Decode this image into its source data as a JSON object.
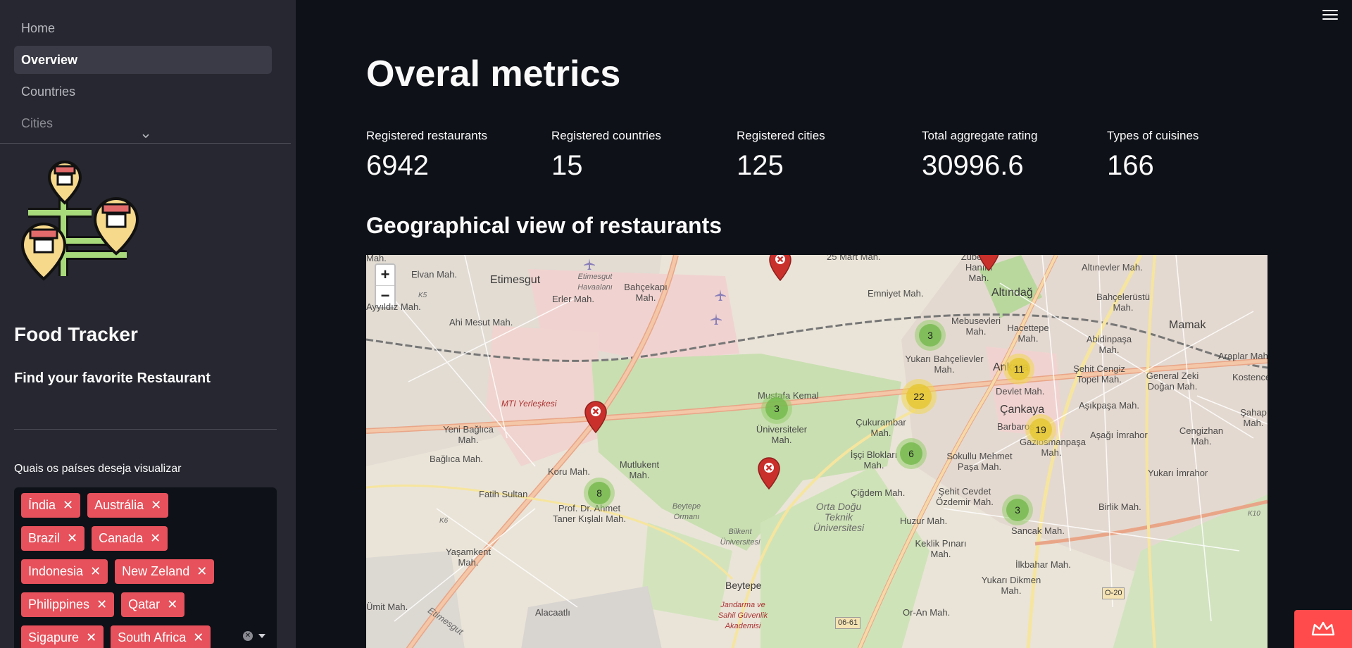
{
  "sidebar": {
    "nav": [
      {
        "label": "Home",
        "active": false
      },
      {
        "label": "Overview",
        "active": true
      },
      {
        "label": "Countries",
        "active": false
      },
      {
        "label": "Cities",
        "active": false
      }
    ],
    "brand": "Food Tracker",
    "subtitle": "Find your favorite Restaurant",
    "filter": {
      "label": "Quais os países deseja visualizar",
      "tags": [
        "Índia",
        "Austrália",
        "Brazil",
        "Canada",
        "Indonesia",
        "New Zeland",
        "Philippines",
        "Qatar",
        "Sigapure",
        "South Africa"
      ]
    }
  },
  "main": {
    "title": "Overal metrics",
    "metrics": [
      {
        "label": "Registered restaurants",
        "value": "6942"
      },
      {
        "label": "Registered countries",
        "value": "15"
      },
      {
        "label": "Registered cities",
        "value": "125"
      },
      {
        "label": "Total aggregate rating",
        "value": "30996.6"
      },
      {
        "label": "Types of cuisines",
        "value": "166"
      }
    ],
    "map_title": "Geographical view of restaurants"
  },
  "map": {
    "zoom_in": "+",
    "zoom_out": "−",
    "labels": {
      "l1": "Elvan Mah.",
      "l2": "Etimesgut",
      "l3": "Etimesgut Havaalanı",
      "l4": "Bahçekapı Mah.",
      "l5": "25 Mart Mah.",
      "l6": "Zübeyde Hanım Mah.",
      "l7": "Altınevler Mah.",
      "l8": "Erler Mah.",
      "l9": "Ahi Mesut Mah.",
      "l10": "Emniyet Mah.",
      "l11": "Altındağ",
      "l12": "Bahçelerüstü Mah.",
      "l13": "Mamak",
      "l14": "Mebusevleri Mah.",
      "l15": "Hacettepe Mah.",
      "l16": "Abidinpaşa Mah.",
      "l17": "Yukarı Bahçelievler Mah.",
      "l18": "Ankara",
      "l19": "Şehit Cengiz Topel Mah.",
      "l20": "General Zeki Doğan Mah.",
      "l21": "Araplar Mah.",
      "l22": "Kostence",
      "l23": "Devlet Mah.",
      "l24": "MTI Yerleşkesi",
      "l25": "Mustafa Kemal",
      "l26": "Çankaya",
      "l27": "Aşıkpaşa Mah.",
      "l28": "Yeni Bağlıca Mah.",
      "l29": "Üniversiteler Mah.",
      "l30": "Çukurambar Mah.",
      "l31": "Barbaros",
      "l32": "Gaziosmanpaşa Mah.",
      "l33": "Aşağı İmrahor",
      "l34": "Cengizhan Mah.",
      "l35": "Şahap Mah.",
      "l36": "Bağlıca Mah.",
      "l37": "Mutlukent Mah.",
      "l38": "İşçi Blokları Mah.",
      "l39": "Sokullu Mehmet Paşa Mah.",
      "l40": "Yukarı İmrahor",
      "l41": "Koru Mah.",
      "l42": "Fatih Sultan",
      "l43": "Çiğdem Mah.",
      "l44": "Şehit Cevdet Özdemir Mah.",
      "l45": "Prof. Dr. Ahmet Taner Kışlalı Mah.",
      "l46": "Beytepe Ormanı",
      "l47": "Bilkent Üniversitesi",
      "l48": "Orta Doğu Teknik Üniversitesi",
      "l49": "Huzur Mah.",
      "l50": "Sancak Mah.",
      "l51": "Birlik Mah.",
      "l52": "Yaşamkent Mah.",
      "l53": "Keklik Pınarı Mah.",
      "l54": "İlkbahar Mah.",
      "l55": "Yukarı Dikmen Mah.",
      "l56": "Beytepe",
      "l57": "Jandarma ve Sahil Güvenlik Akademisi",
      "l58": "Alacaatlı",
      "l59": "Or-An Mah.",
      "l60": "Ümit Mah.",
      "l61": "Etimesgut",
      "l62": "Mah.",
      "l63": "Ayyıldız Mah."
    },
    "roads": {
      "r1": "06-61",
      "r2": "O-20",
      "r3": "K5",
      "r4": "K6",
      "r5": "K10"
    },
    "clusters": [
      {
        "count": "3",
        "color": "green"
      },
      {
        "count": "11",
        "color": "yellow"
      },
      {
        "count": "22",
        "color": "yellow"
      },
      {
        "count": "3",
        "color": "green"
      },
      {
        "count": "19",
        "color": "yellow"
      },
      {
        "count": "6",
        "color": "green"
      },
      {
        "count": "8",
        "color": "green"
      },
      {
        "count": "3",
        "color": "green"
      }
    ]
  },
  "colors": {
    "accent": "#ff4b4b",
    "tag": "#e6515b",
    "sidebar": "#262730",
    "background": "#0e1117"
  }
}
